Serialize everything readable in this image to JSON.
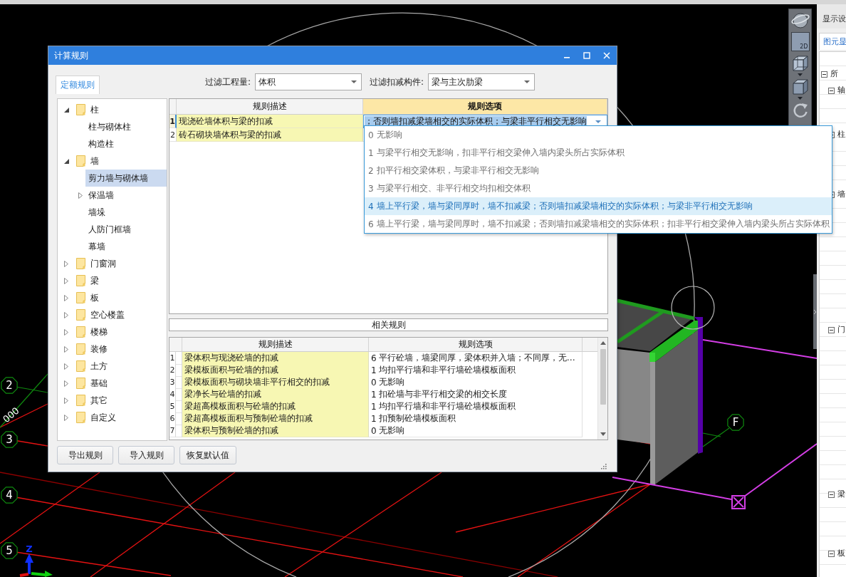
{
  "canvas": {
    "grid_bubbles": [
      "2",
      "3",
      "4",
      "5",
      "F"
    ],
    "dimension": "000",
    "axis_label": "Z"
  },
  "view_toolbar": {
    "buttons": [
      {
        "kind": "orbit"
      },
      {
        "kind": "plan",
        "label": "2D"
      },
      {
        "kind": "wireframe",
        "has_menu": true
      },
      {
        "kind": "solid",
        "has_menu": true
      },
      {
        "kind": "rotate"
      }
    ]
  },
  "side_panel": {
    "title": "显示设",
    "tabs": [
      {
        "label": "图元显",
        "selected": true
      }
    ],
    "tree": [
      {
        "label": "所",
        "expanded": true,
        "children": [
          {
            "label": "轴",
            "expanded": true
          },
          {
            "label": "柱",
            "expanded": true
          },
          {
            "label": "墙",
            "expanded": true
          },
          {
            "label": "门",
            "expanded": true
          },
          {
            "label": "梁",
            "expanded": true
          },
          {
            "label": "板",
            "expanded": true
          }
        ]
      }
    ]
  },
  "dialog": {
    "title": "计算规则",
    "tabs": [
      {
        "label": "定额规则",
        "selected": true
      }
    ],
    "filters": [
      {
        "label": "过滤工程量:",
        "value": "体积"
      },
      {
        "label": "过滤扣减构件:",
        "value": "梁与主次肋梁"
      }
    ],
    "tree": [
      {
        "label": "柱",
        "expanded": true,
        "selected": false,
        "children": [
          {
            "label": "柱与砌体柱",
            "selected": false
          },
          {
            "label": "构造柱",
            "selected": false
          }
        ]
      },
      {
        "label": "墙",
        "expanded": true,
        "selected": false,
        "children": [
          {
            "label": "剪力墙与砌体墙",
            "selected": true
          },
          {
            "label": "保温墙",
            "expanded": false,
            "selected": false
          },
          {
            "label": "墙垛",
            "selected": false
          },
          {
            "label": "人防门框墙",
            "selected": false
          },
          {
            "label": "幕墙",
            "selected": false
          }
        ]
      },
      {
        "label": "门窗洞",
        "expanded": false,
        "selected": false
      },
      {
        "label": "梁",
        "expanded": false,
        "selected": false
      },
      {
        "label": "板",
        "expanded": false,
        "selected": false
      },
      {
        "label": "空心楼盖",
        "expanded": false,
        "selected": false
      },
      {
        "label": "楼梯",
        "expanded": false,
        "selected": false
      },
      {
        "label": "装修",
        "expanded": false,
        "selected": false
      },
      {
        "label": "土方",
        "expanded": false,
        "selected": false
      },
      {
        "label": "基础",
        "expanded": false,
        "selected": false
      },
      {
        "label": "其它",
        "expanded": false,
        "selected": false
      },
      {
        "label": "自定义",
        "expanded": false,
        "selected": false
      }
    ],
    "rules_table": {
      "columns": [
        {
          "label": "规则描述",
          "selected": false
        },
        {
          "label": "规则选项",
          "selected": true
        }
      ],
      "rows": [
        {
          "number": "1",
          "description": "现浇砼墙体积与梁的扣减",
          "option": "；否则墙扣减梁墙相交的实际体积；与梁非平行相交无影响",
          "selected": true
        },
        {
          "number": "2",
          "description": "砖石砌块墙体积与梁的扣减",
          "selected": false
        }
      ]
    },
    "related_title": "相关规则",
    "related_table": {
      "columns": [
        "规则描述",
        "规则选项"
      ],
      "rows": [
        {
          "number": "1",
          "description": "梁体积与现浇砼墙的扣减",
          "option_number": "6",
          "option": "平行砼墙，墙梁同厚，梁体积并入墙；不同厚，无…"
        },
        {
          "number": "2",
          "description": "梁模板面积与砼墙的扣减",
          "option_number": "1",
          "option": "均扣平行墙和非平行墙砼墙模板面积"
        },
        {
          "number": "3",
          "description": "梁模板面积与砌块墙非平行相交的扣减",
          "option_number": "0",
          "option": "无影响"
        },
        {
          "number": "4",
          "description": "梁净长与砼墙的扣减",
          "option_number": "1",
          "option": "扣砼墙与非平行相交梁的相交长度"
        },
        {
          "number": "5",
          "description": "梁超高模板面积与砼墙的扣减",
          "option_number": "1",
          "option": "均扣平行墙和非平行墙砼墙模板面积"
        },
        {
          "number": "6",
          "description": "梁超高模板面积与预制砼墙的扣减",
          "option_number": "1",
          "option": "扣预制砼墙模板面积"
        },
        {
          "number": "7",
          "description": "梁体积与预制砼墙的扣减",
          "option_number": "0",
          "option": "无影响"
        }
      ]
    },
    "buttons": [
      "导出规则",
      "导入规则",
      "恢复默认值"
    ]
  },
  "option_dropdown": {
    "items": [
      {
        "number": "0",
        "text": "无影响",
        "selected": false
      },
      {
        "number": "1",
        "text": "与梁平行相交无影响，扣非平行相交梁伸入墙内梁头所占实际体积",
        "selected": false
      },
      {
        "number": "2",
        "text": "扣平行相交梁体积，与梁非平行相交无影响",
        "selected": false
      },
      {
        "number": "3",
        "text": "与梁平行相交、非平行相交均扣相交体积",
        "selected": false
      },
      {
        "number": "4",
        "text": "墙上平行梁，墙与梁同厚时，墙不扣减梁；否则墙扣减梁墙相交的实际体积；与梁非平行相交无影响",
        "selected": true
      },
      {
        "number": "6",
        "text": "墙上平行梁，墙与梁同厚时，墙不扣减梁；否则墙扣减梁墙相交的实际体积；扣非平行相交梁伸入墙内梁头所占实际体积",
        "selected": false
      }
    ]
  }
}
